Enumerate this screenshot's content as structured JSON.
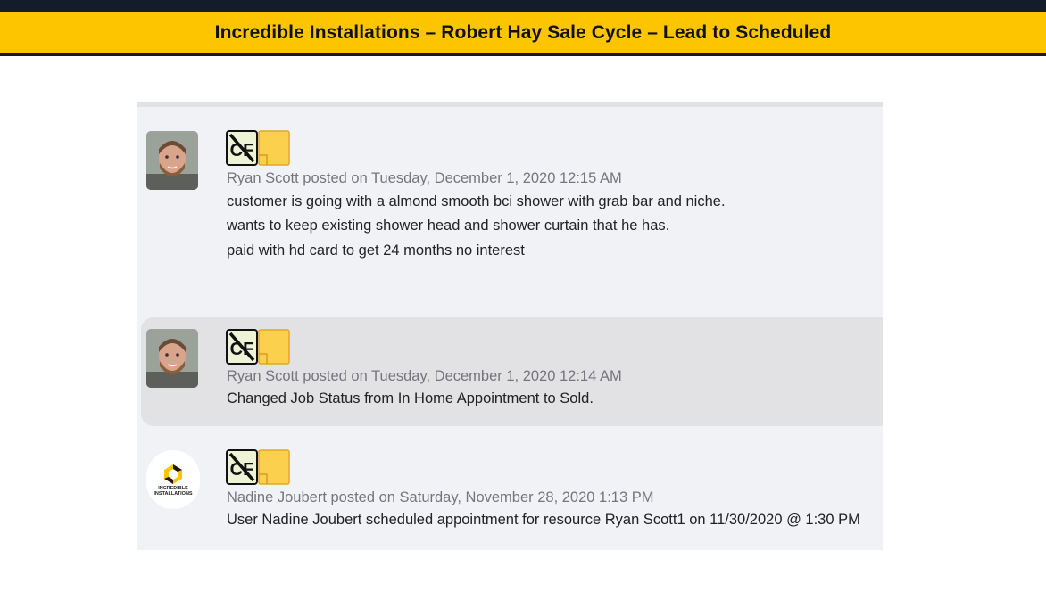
{
  "banner": {
    "title": "Incredible Installations – Robert Hay Sale Cycle – Lead to Scheduled"
  },
  "colors": {
    "banner_bg": "#fcc500",
    "feed_bg": "#f1f2f6",
    "highlight_bg": "#e2e2e5",
    "meta_text": "#74767c"
  },
  "posts": [
    {
      "avatar": "user-photo-avatar",
      "meta": "Ryan Scott posted on Tuesday, December 1, 2020 12:15 AM",
      "lines": [
        "customer is going with a almond smooth bci shower with grab bar and niche.",
        "wants to keep existing shower head and shower curtain that he has.",
        "paid with hd card to get 24 months no interest"
      ]
    },
    {
      "avatar": "user-photo-avatar",
      "meta": "Ryan Scott posted on Tuesday, December 1, 2020 12:14 AM",
      "lines": [
        "Changed Job Status from In Home Appointment to Sold."
      ]
    },
    {
      "avatar": "company-logo-avatar",
      "logo_text": [
        "INCREDIBLE",
        "INSTALLATIONS"
      ],
      "meta": "Nadine Joubert posted on Saturday, November 28, 2020 1:13 PM",
      "lines": [
        "User Nadine Joubert scheduled appointment for resource Ryan Scott1 on 11/30/2020 @ 1:30 PM"
      ]
    }
  ]
}
